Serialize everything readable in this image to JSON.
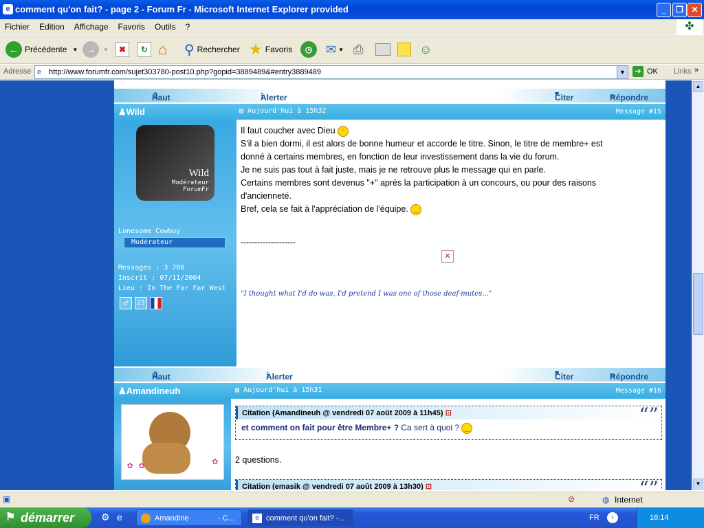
{
  "window": {
    "title": "comment qu'on fait? - page 2 - Forum Fr - Microsoft Internet Explorer provided"
  },
  "menu": [
    "Fichier",
    "Edition",
    "Affichage",
    "Favoris",
    "Outils",
    "?"
  ],
  "toolbar": {
    "back": "Précédente",
    "search": "Rechercher",
    "favorites": "Favoris"
  },
  "address": {
    "label": "Adresse",
    "url": "http://www.forumfr.com/sujet303780-post10.php?gopid=3889489&#entry3889489",
    "go": "OK",
    "links": "Links"
  },
  "topbar": {
    "haut": "Haut",
    "alerter": "Alerter",
    "citer": "Citer",
    "repondre": "Répondre"
  },
  "posts": [
    {
      "author": "Wild",
      "date": "Aujourd'hui à 15h32",
      "msgnum": "Message #15",
      "avatar_text": [
        "Wild",
        "Modérateur",
        "ForumFr"
      ],
      "title": "Lonesome Cowboy",
      "rank": "Modérateur",
      "stats": [
        "Messages : 3 700",
        "Inscrit : 07/11/2004",
        "Lieu : In The Far Far West"
      ],
      "age": "23",
      "body": [
        "Il faut coucher avec Dieu",
        "S'il a bien dormi, il est alors de bonne humeur et accorde le titre. Sinon, le titre de membre+ est",
        "donné à certains membres, en fonction de leur investissement dans la vie du forum.",
        "Je ne suis pas tout à fait juste, mais je ne retrouve plus le message qui en parle.",
        "Certains membres sont devenus \"+\" après la participation à un concours, ou pour des raisons",
        "d'ancienneté.",
        "Bref, cela se fait à l'appréciation de l'équipe."
      ],
      "separator": "--------------------",
      "signature": "\"I thought what I'd do was, I'd pretend I was one of those deaf-mutes...\""
    },
    {
      "author": "Amandineuh",
      "date": "Aujourd'hui à 15h31",
      "msgnum": "Message #16",
      "quote1_head": "Citation (Amandineuh @ vendredi 07 août 2009 à 11h45)",
      "quote1_bold": "et comment on fait pour être Membre+ ?",
      "quote1_rest": " Ca sert à quoi ?",
      "line": "2 questions.",
      "quote2_head": "Citation (emasik @ vendredi 07 août 2009 à 13h30)"
    }
  ],
  "statusbar": {
    "zone": "Internet"
  },
  "taskbar": {
    "start": "démarrer",
    "tasks": [
      "Amandine",
      "- C...",
      "comment qu'on fait? -..."
    ],
    "lang": "FR",
    "clock": "16:14"
  },
  "colors": {
    "page_bg": "#1a56b8",
    "post_header": "#37aee4",
    "profile": "#4db5e8"
  }
}
